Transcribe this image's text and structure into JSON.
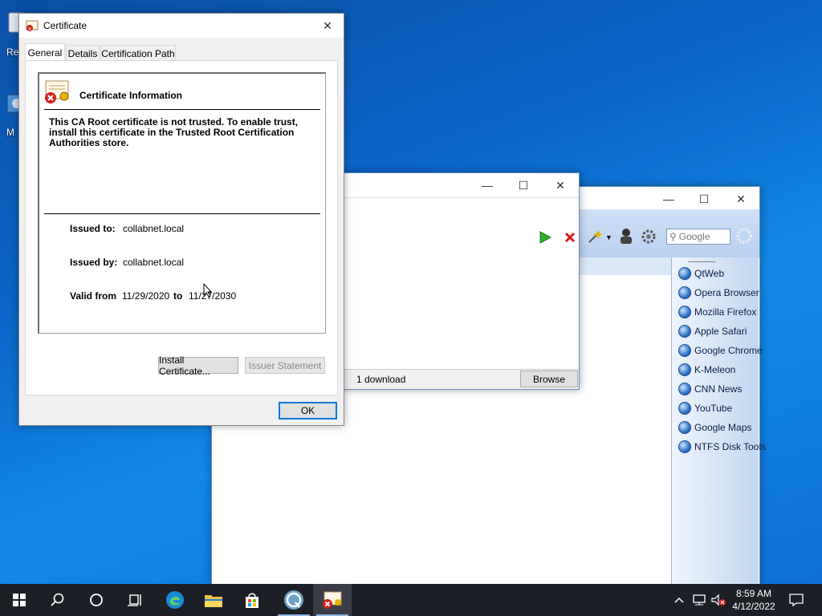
{
  "desktop": {
    "icons": [
      {
        "label": "Re"
      },
      {
        "label": "M"
      }
    ]
  },
  "browser_window": {
    "controls": {
      "minimize": "—",
      "maximize": "☐",
      "close": "✕"
    },
    "search": {
      "placeholder": "Google"
    },
    "bookmarks_header": "...................",
    "bookmarks": [
      {
        "label": "QtWeb"
      },
      {
        "label": "Opera Browser"
      },
      {
        "label": "Mozilla Firefox"
      },
      {
        "label": "Apple Safari"
      },
      {
        "label": "Google Chrome"
      },
      {
        "label": "K-Meleon"
      },
      {
        "label": "CNN News"
      },
      {
        "label": "YouTube"
      },
      {
        "label": "Google Maps"
      },
      {
        "label": "NTFS Disk Tools"
      }
    ]
  },
  "download_window": {
    "controls": {
      "minimize": "—",
      "maximize": "☐",
      "close": "✕"
    },
    "status_text": "1 download",
    "browse_label": "Browse"
  },
  "certificate_dialog": {
    "title": "Certificate",
    "close": "✕",
    "tabs": [
      {
        "label": "General",
        "active": true
      },
      {
        "label": "Details",
        "active": false
      },
      {
        "label": "Certification Path",
        "active": false
      }
    ],
    "info_title": "Certificate Information",
    "warning_lines": [
      "This CA Root certificate is not trusted. To enable trust,",
      "install this certificate in the Trusted Root Certification",
      "Authorities store."
    ],
    "issued_to_label": "Issued to:",
    "issued_to_value": "collabnet.local",
    "issued_by_label": "Issued by:",
    "issued_by_value": "collabnet.local",
    "valid_from_label": "Valid from",
    "valid_from_value": "11/29/2020",
    "valid_to_label": "to",
    "valid_to_value": "11/27/2030",
    "install_button": "Install Certificate...",
    "issuer_button": "Issuer Statement",
    "ok_button": "OK"
  },
  "taskbar": {
    "time": "8:59 AM",
    "date": "4/12/2022",
    "apps": [
      "start",
      "search",
      "cortana",
      "task-view",
      "edge",
      "file-explorer",
      "store",
      "qtweb",
      "certificate"
    ]
  }
}
